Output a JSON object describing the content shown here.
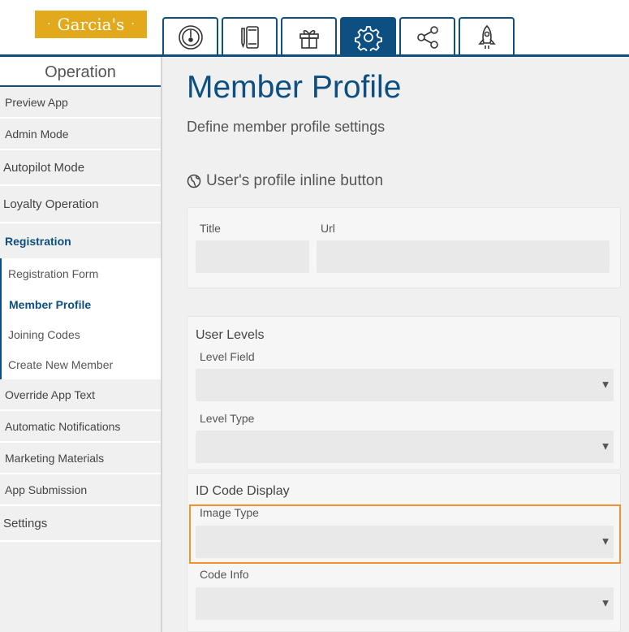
{
  "brand": {
    "name": "Garcia's",
    "accent": "#e3a91d",
    "primary": "#0c4f80",
    "highlight": "#f0922d"
  },
  "tabs": [
    {
      "icon": "dashboard-gauge-icon",
      "active": false
    },
    {
      "icon": "mobile-pencil-icon",
      "active": false
    },
    {
      "icon": "gift-icon",
      "active": false
    },
    {
      "icon": "gear-icon",
      "active": true
    },
    {
      "icon": "share-icon",
      "active": false
    },
    {
      "icon": "rocket-icon",
      "active": false
    }
  ],
  "sidebar": {
    "heading": "Operation",
    "items": [
      {
        "label": "Preview App"
      },
      {
        "label": "Admin Mode"
      },
      {
        "label": "Autopilot Mode"
      },
      {
        "label": "Loyalty Operation"
      },
      {
        "label": "Registration"
      }
    ],
    "sub_items": [
      {
        "label": "Registration Form"
      },
      {
        "label": "Member Profile"
      },
      {
        "label": "Joining Codes"
      },
      {
        "label": "Create New Member"
      }
    ],
    "items_after": [
      {
        "label": "Override App Text"
      },
      {
        "label": "Automatic Notifications"
      },
      {
        "label": "Marketing Materials"
      },
      {
        "label": "App Submission"
      },
      {
        "label": "Settings"
      }
    ]
  },
  "main": {
    "title": "Member Profile",
    "subtitle": "Define member profile settings",
    "inline_section": {
      "heading": "User's profile inline button",
      "title_label": "Title",
      "url_label": "Url"
    },
    "user_levels": {
      "heading": "User Levels",
      "level_field_label": "Level Field",
      "level_type_label": "Level Type"
    },
    "id_code": {
      "heading": "ID Code Display",
      "image_type_label": "Image Type",
      "code_info_label": "Code Info"
    },
    "select_arrow": "▼"
  }
}
